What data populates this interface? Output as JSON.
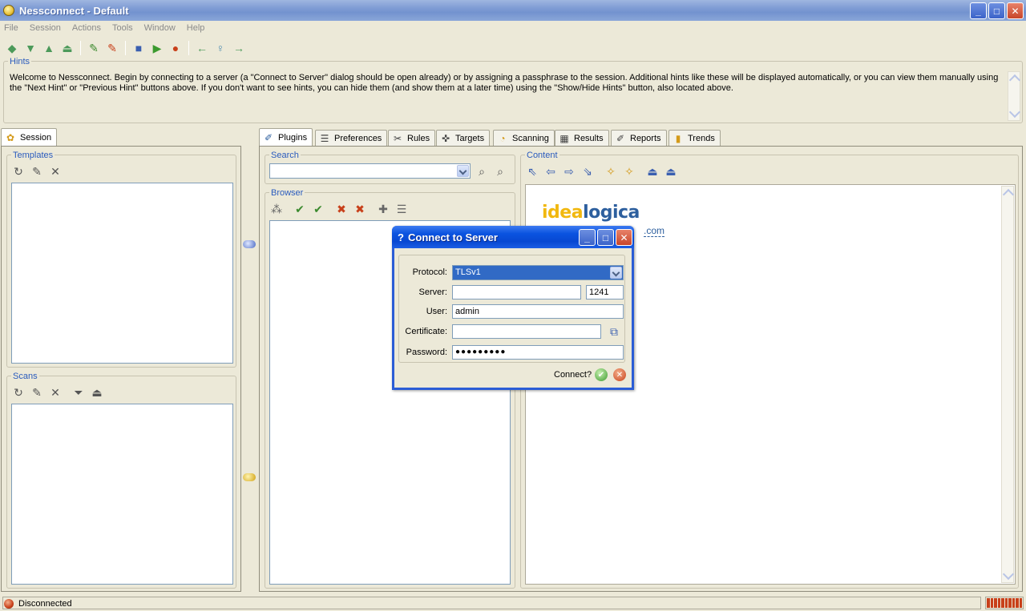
{
  "window": {
    "title": "Nessconnect - Default"
  },
  "menu": [
    "File",
    "Session",
    "Actions",
    "Tools",
    "Window",
    "Help"
  ],
  "hints": {
    "label": "Hints",
    "text": "Welcome to Nessconnect. Begin by connecting to a server (a \"Connect to Server\" dialog should be open already) or by assigning a passphrase to the session. Additional hints like these will be displayed automatically, or you can view them manually using the \"Next Hint\" or \"Previous Hint\" buttons above. If you don't want to see hints, you can hide them (and show them at a later time) using the \"Show/Hide Hints\" button, also located above."
  },
  "left_tabs": [
    "Session"
  ],
  "session": {
    "templates_label": "Templates",
    "scans_label": "Scans"
  },
  "main_tabs": [
    "Plugins",
    "Preferences",
    "Rules",
    "Targets",
    "Scanning",
    "Results",
    "Reports",
    "Trends"
  ],
  "plugins": {
    "search_label": "Search",
    "browser_label": "Browser",
    "content_label": "Content"
  },
  "content": {
    "logo_part1": "idea",
    "logo_part2": "logica",
    "link_text": ".com"
  },
  "dialog": {
    "title": "Connect to Server",
    "protocol_label": "Protocol:",
    "protocol_value": "TLSv1",
    "server_label": "Server:",
    "server_value": "",
    "port_value": "1241",
    "user_label": "User:",
    "user_value": "admin",
    "certificate_label": "Certificate:",
    "certificate_value": "",
    "password_label": "Password:",
    "password_value": "●●●●●●●●●",
    "connect_label": "Connect?"
  },
  "status": {
    "text": "Disconnected",
    "progress_segments": 10
  },
  "colors": {
    "accent": "#2a5bbd",
    "titlebar": "#7e9bd4",
    "dialog_title": "#0a53e0",
    "status_red": "#c8401a"
  }
}
